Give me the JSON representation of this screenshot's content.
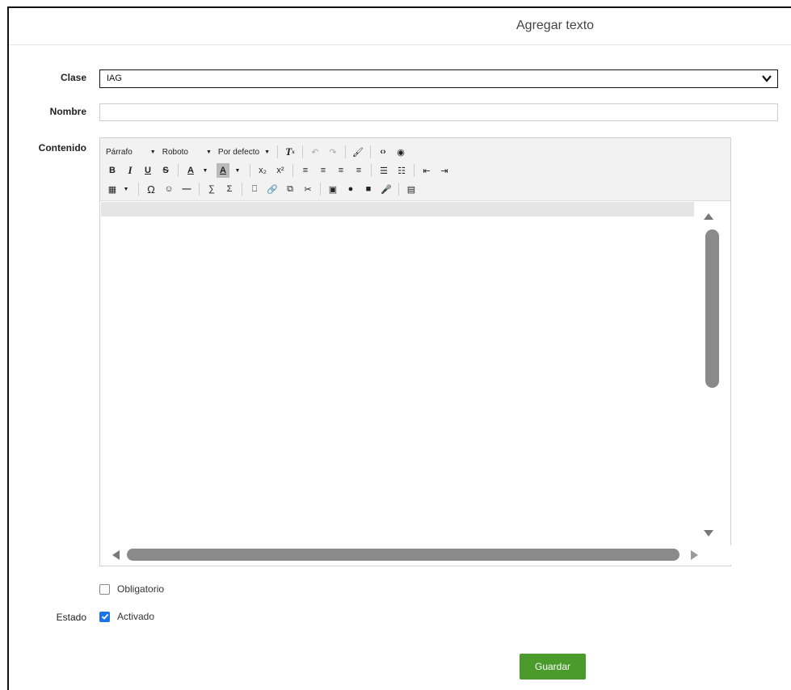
{
  "dialog": {
    "title": "Agregar texto"
  },
  "form": {
    "clase_label": "Clase",
    "clase_value": "IAG",
    "nombre_label": "Nombre",
    "nombre_value": "",
    "contenido_label": "Contenido",
    "estado_label": "Estado"
  },
  "toolbar": {
    "paragraph": "Párrafo",
    "font": "Roboto",
    "size": "Por defecto",
    "bold": "B",
    "italic": "I",
    "underline": "U",
    "strike": "S",
    "font_color": "A",
    "bg_color": "A",
    "subscript": "x₂",
    "superscript": "x²",
    "special_char": "Ω",
    "sigma": "Σ"
  },
  "checkboxes": {
    "obligatorio_label": "Obligatorio",
    "obligatorio_checked": false,
    "activado_label": "Activado",
    "activado_checked": true
  },
  "actions": {
    "save_label": "Guardar"
  },
  "colors": {
    "accent_green": "#4a9a2c",
    "checkbox_blue": "#1a73e8"
  }
}
